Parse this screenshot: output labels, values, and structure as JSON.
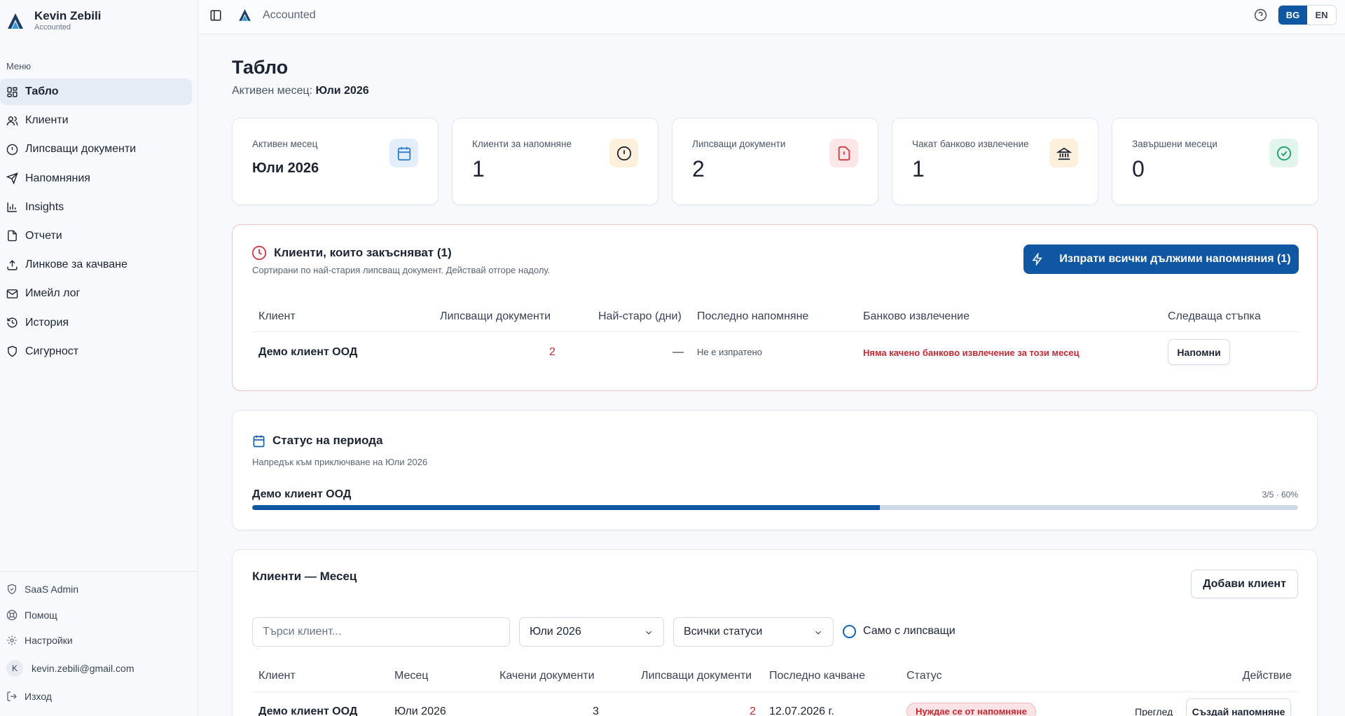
{
  "sidebar": {
    "user_name": "Kevin Zebili",
    "org_name": "Accounted",
    "menu_label": "Меню",
    "items": [
      {
        "label": "Табло",
        "icon": "dashboard-icon"
      },
      {
        "label": "Клиенти",
        "icon": "users-icon"
      },
      {
        "label": "Липсващи документи",
        "icon": "alert-circle-icon"
      },
      {
        "label": "Напомняния",
        "icon": "send-icon"
      },
      {
        "label": "Insights",
        "icon": "bar-chart-icon"
      },
      {
        "label": "Отчети",
        "icon": "file-icon"
      },
      {
        "label": "Линкове за качване",
        "icon": "upload-icon"
      },
      {
        "label": "Имейл лог",
        "icon": "mail-icon"
      },
      {
        "label": "История",
        "icon": "history-icon"
      },
      {
        "label": "Сигурност",
        "icon": "shield-icon"
      }
    ],
    "bottom": {
      "saas_admin": "SaaS Admin",
      "help": "Помощ",
      "settings": "Настройки",
      "avatar_initial": "K",
      "email": "kevin.zebili@gmail.com",
      "logout": "Изход"
    }
  },
  "topbar": {
    "title": "Accounted",
    "lang_bg": "BG",
    "lang_en": "EN",
    "active_lang": "BG"
  },
  "page": {
    "title": "Табло",
    "active_month_label": "Активен месец:",
    "active_month_value": "Юли 2026"
  },
  "stats": [
    {
      "label": "Активен месец",
      "value": "Юли 2026",
      "icon": "calendar-icon",
      "color": "#2f80c8",
      "bg": "#e3eefa"
    },
    {
      "label": "Клиенти за напомняне",
      "value": "1",
      "icon": "alert-circle-icon",
      "color": "#1c2433",
      "bg": "#fdf0dd"
    },
    {
      "label": "Липсващи документи",
      "value": "2",
      "icon": "file-alert-icon",
      "color": "#d33a46",
      "bg": "#fde6e8"
    },
    {
      "label": "Чакат банково извлечение",
      "value": "1",
      "icon": "bank-icon",
      "color": "#1c2433",
      "bg": "#fdf0dd"
    },
    {
      "label": "Завършени месеци",
      "value": "0",
      "icon": "check-circle-icon",
      "color": "#1e9e6a",
      "bg": "#e1f5ec"
    }
  ],
  "late": {
    "title": "Клиенти, които закъсняват (1)",
    "subtitle": "Сортирани по най-стария липсващ документ. Действай отгоре надолу.",
    "send_all_label": "Изпрати всички дължими напомняния (1)",
    "columns": [
      "Клиент",
      "Липсващи документи",
      "Най-старо (дни)",
      "Последно напомняне",
      "Банково извлечение",
      "Следваща стъпка"
    ],
    "rows": [
      {
        "client": "Демо клиент ООД",
        "missing": "2",
        "oldest": "—",
        "last_reminder": "Не е изпратено",
        "bank": "Няма качено банково извлечение за този месец",
        "action": "Напомни"
      }
    ]
  },
  "period": {
    "title": "Статус на периода",
    "subtitle": "Напредък към приключване на Юли 2026",
    "client": "Демо клиент ООД",
    "progress_text": "3/5 · 60%",
    "progress": 0.6
  },
  "clients": {
    "title": "Клиенти — Месец",
    "add_label": "Добави клиент",
    "search_placeholder": "Търси клиент...",
    "month_select": "Юли 2026",
    "status_select": "Всички статуси",
    "only_missing_label": "Само с липсващи",
    "columns": [
      "Клиент",
      "Месец",
      "Качени документи",
      "Липсващи документи",
      "Последно качване",
      "Статус",
      "Действие"
    ],
    "rows": [
      {
        "client": "Демо клиент ООД",
        "month": "Юли 2026",
        "uploaded": "3",
        "missing": "2",
        "last_upload": "12.07.2026 г.",
        "status": "Нуждае се от напомняне",
        "view": "Преглед",
        "create": "Създай напомняне"
      }
    ]
  }
}
